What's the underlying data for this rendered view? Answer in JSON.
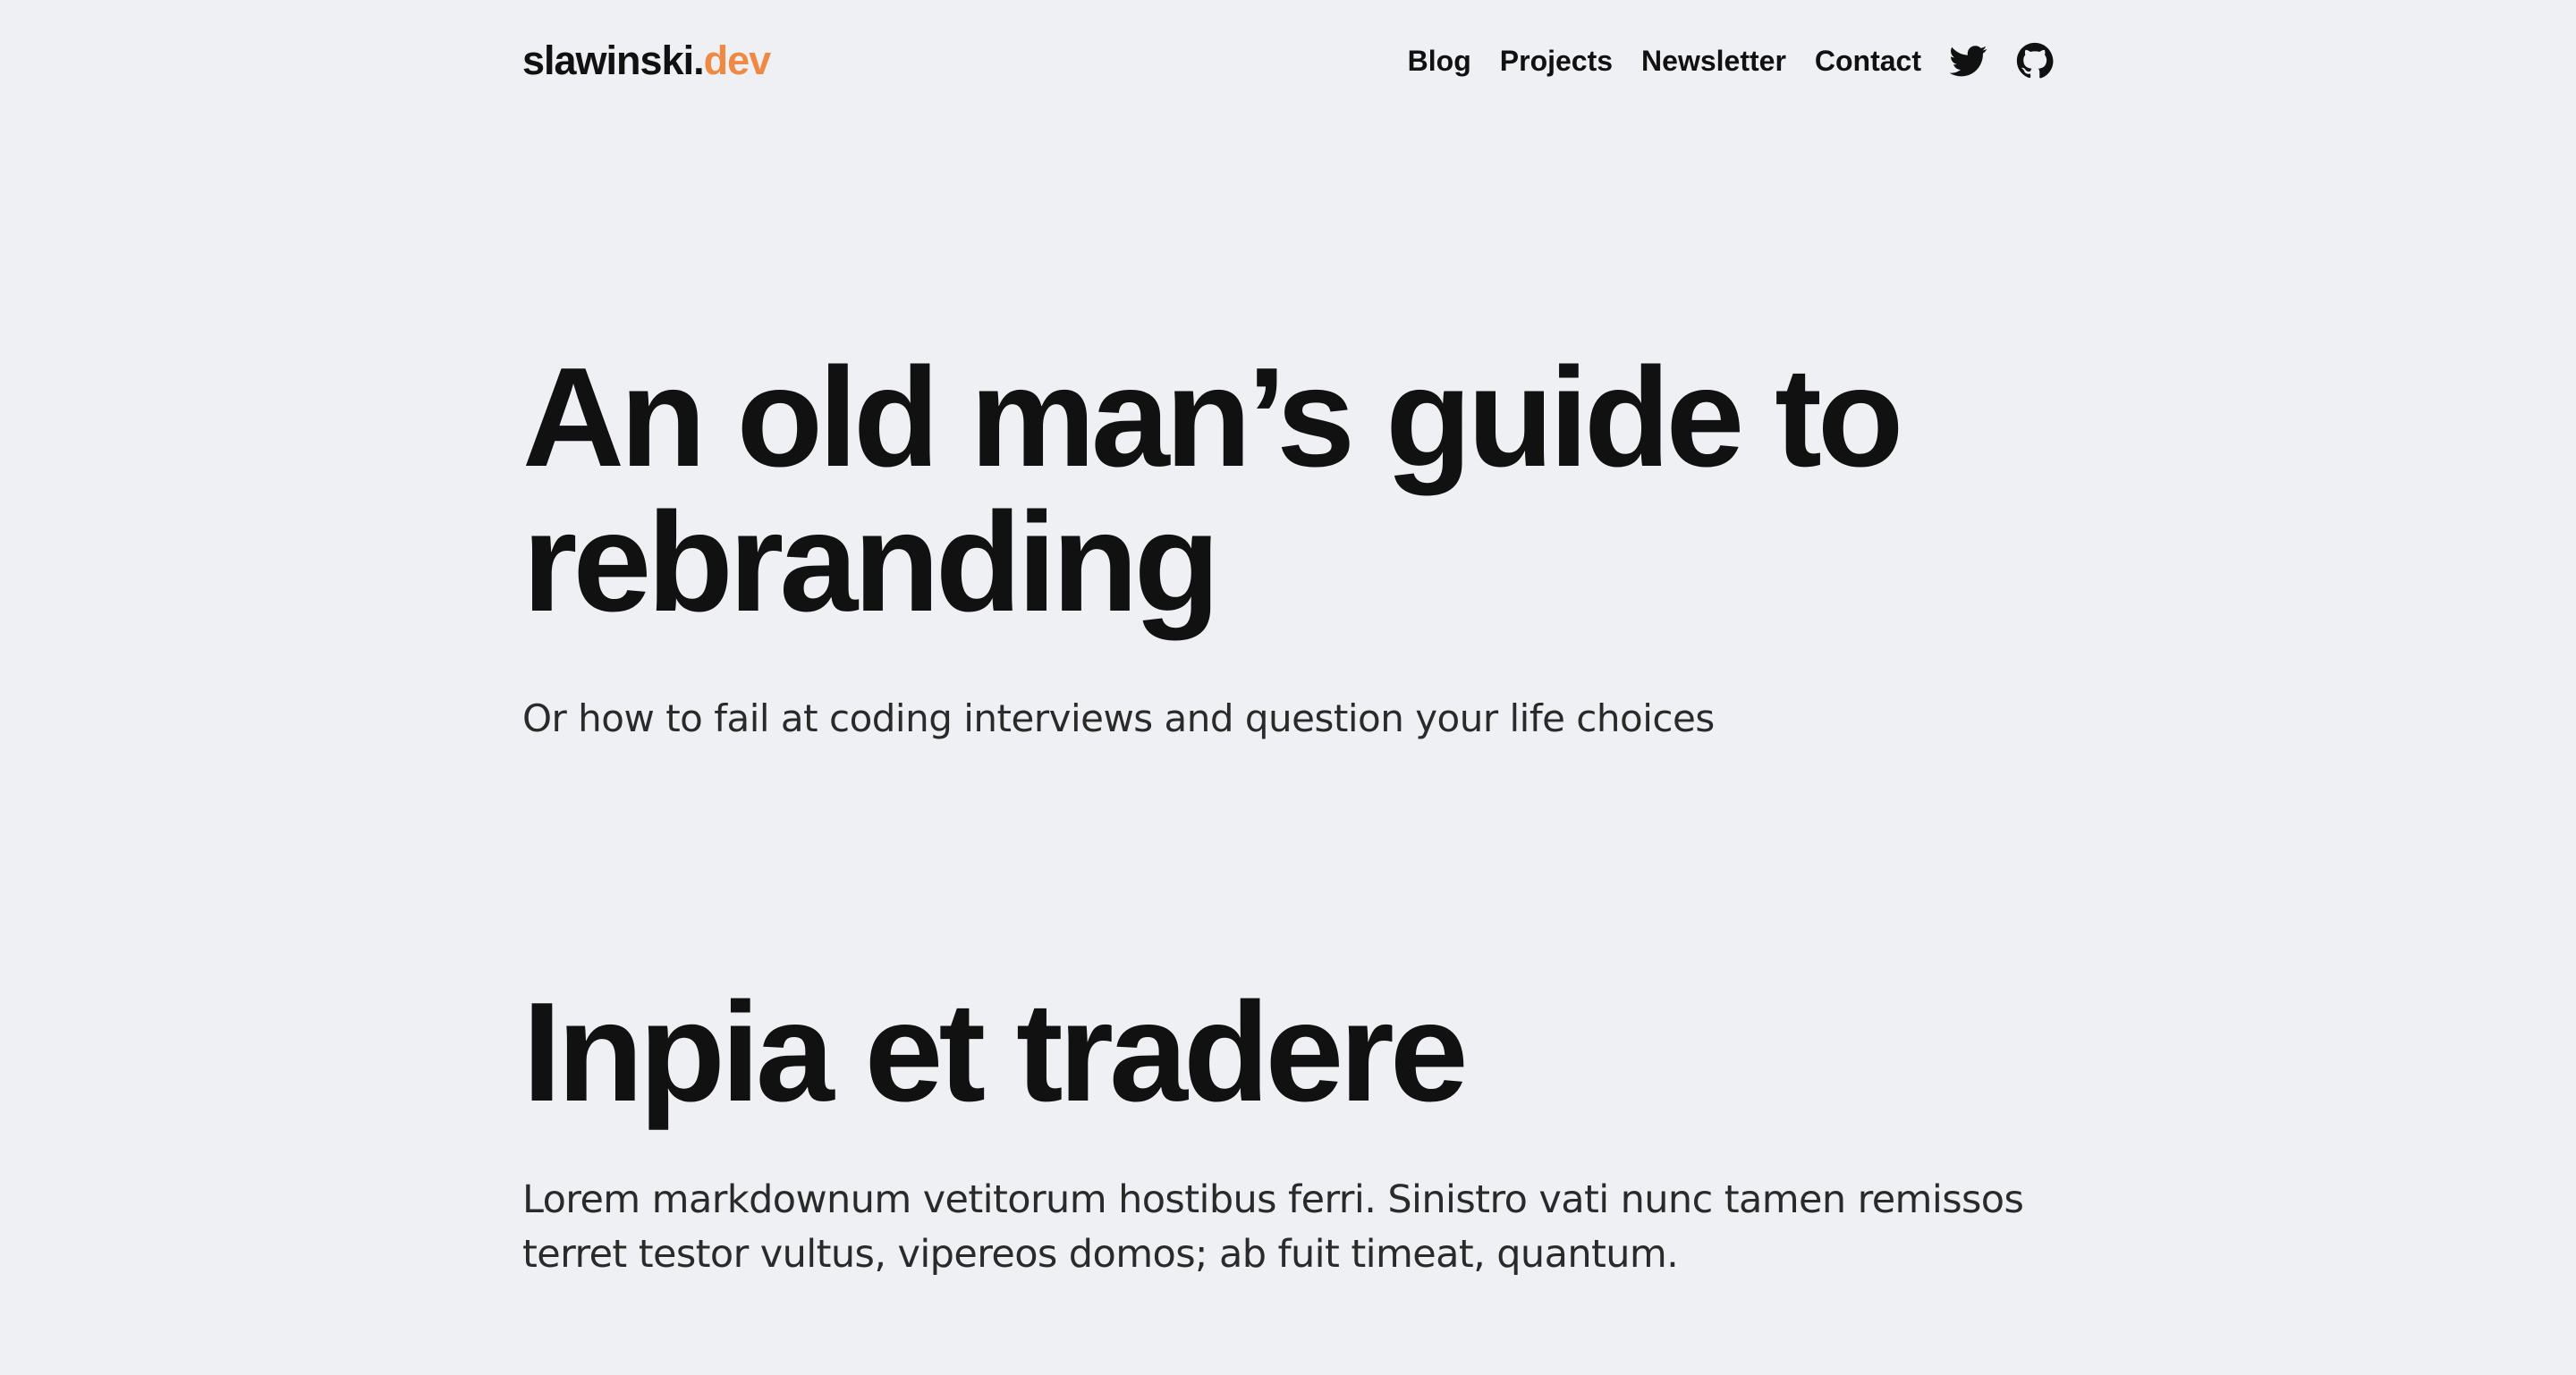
{
  "header": {
    "logo_name": "slawinski.",
    "logo_tld": "dev",
    "nav": {
      "blog": "Blog",
      "projects": "Projects",
      "newsletter": "Newsletter",
      "contact": "Contact"
    },
    "icons": [
      "twitter-icon",
      "github-icon"
    ]
  },
  "article": {
    "title": "An old man’s guide to rebranding",
    "subtitle": "Or how to fail at coding interviews and question your life choices",
    "section_heading": "Inpia et tradere",
    "paragraph": "Lorem markdownum vetitorum hostibus ferri. Sinistro vati nunc tamen remissos terret testor vultus, vipereos domos; ab fuit timeat, quantum."
  },
  "colors": {
    "background": "#eff0f3",
    "text": "#111111",
    "accent": "#ef8a45"
  }
}
